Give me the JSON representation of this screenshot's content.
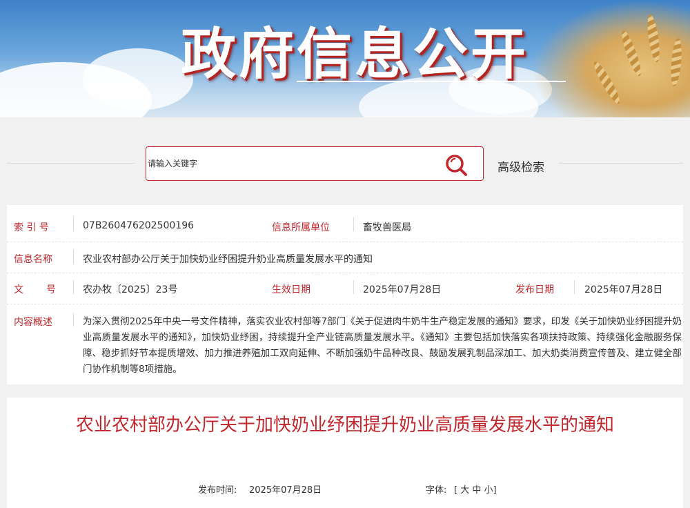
{
  "banner": {
    "title": "政府信息公开"
  },
  "search": {
    "placeholder": "请输入关键字",
    "advanced_label": "高级检索"
  },
  "info": {
    "index_label": "索 引 号",
    "index_value": "07B260476202500196",
    "org_label": "信息所属单位",
    "org_value": "畜牧兽医局",
    "name_label": "信息名称",
    "name_value": "农业农村部办公厅关于加快奶业纾困提升奶业高质量发展水平的通知",
    "docno_label_1": "文",
    "docno_label_2": "号",
    "docno_value": "农办牧〔2025〕23号",
    "effective_label": "生效日期",
    "effective_value": "2025年07月28日",
    "publish_label": "发布日期",
    "publish_value": "2025年07月28日",
    "summary_label": "内容概述",
    "summary_value": "为深入贯彻2025年中央一号文件精神，落实农业农村部等7部门《关于促进肉牛奶牛生产稳定发展的通知》要求，印发《关于加快奶业纾困提升奶业高质量发展水平的通知》，加快奶业纾困，持续提升全产业链高质量发展水平。《通知》主要包括加快落实各项扶持政策、持续强化金融服务保障、稳步抓好节本提质增效、加力推进养殖加工双向延伸、不断加强奶牛品种改良、鼓励发展乳制品深加工、加大奶类消费宣传普及、建立健全部门协作机制等8项措施。"
  },
  "article": {
    "title": "农业农村部办公厅关于加快奶业纾困提升奶业高质量发展水平的通知",
    "pub_date_label": "发布时间:",
    "pub_date_value": "2025年07月28日",
    "font_label": "字体:",
    "font_open": "[",
    "font_large": "大",
    "font_medium": "中",
    "font_small": "小",
    "font_close": "]"
  },
  "colors": {
    "accent": "#c1272d",
    "background": "#f1f1f1"
  },
  "icons": {
    "search": "search-icon"
  }
}
